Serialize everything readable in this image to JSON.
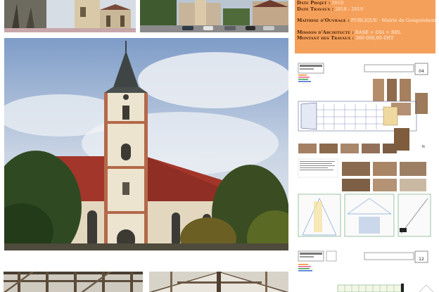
{
  "project_info": {
    "date_projet_label": "Date Projet :",
    "date_projet_value": "2010",
    "date_travaux_label": "Date Travaux :",
    "date_travaux_value": "2018  -  2019",
    "maitrise_label": "Maîtrise d'Ouvrage :",
    "maitrise_value": "PUBLIQUE - Mairie de Geispolsheim",
    "mission_label": "Mission d'Architecte :",
    "mission_value": "BASE + DIA + REL",
    "montant_label": "Montant des Travaux :",
    "montant_value": "360  000,00   €HT"
  },
  "sheets": {
    "sheet1_number": "04",
    "sheet2_number": "12"
  },
  "colors": {
    "info_bg": "#f5a05a",
    "roof_red": "#a3362a",
    "sky": "#c8d3e2"
  }
}
